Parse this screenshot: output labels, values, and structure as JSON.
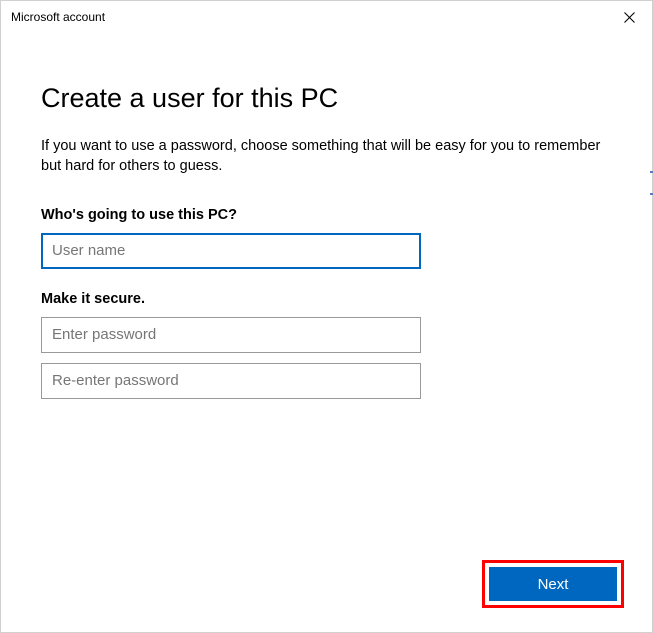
{
  "window": {
    "title": "Microsoft account"
  },
  "page": {
    "title": "Create a user for this PC",
    "description": "If you want to use a password, choose something that will be easy for you to remember but hard for others to guess."
  },
  "sections": {
    "username": {
      "label": "Who's going to use this PC?",
      "placeholder": "User name",
      "value": ""
    },
    "password": {
      "label": "Make it secure.",
      "placeholder1": "Enter password",
      "placeholder2": "Re-enter password",
      "value1": "",
      "value2": ""
    }
  },
  "footer": {
    "next_label": "Next"
  }
}
